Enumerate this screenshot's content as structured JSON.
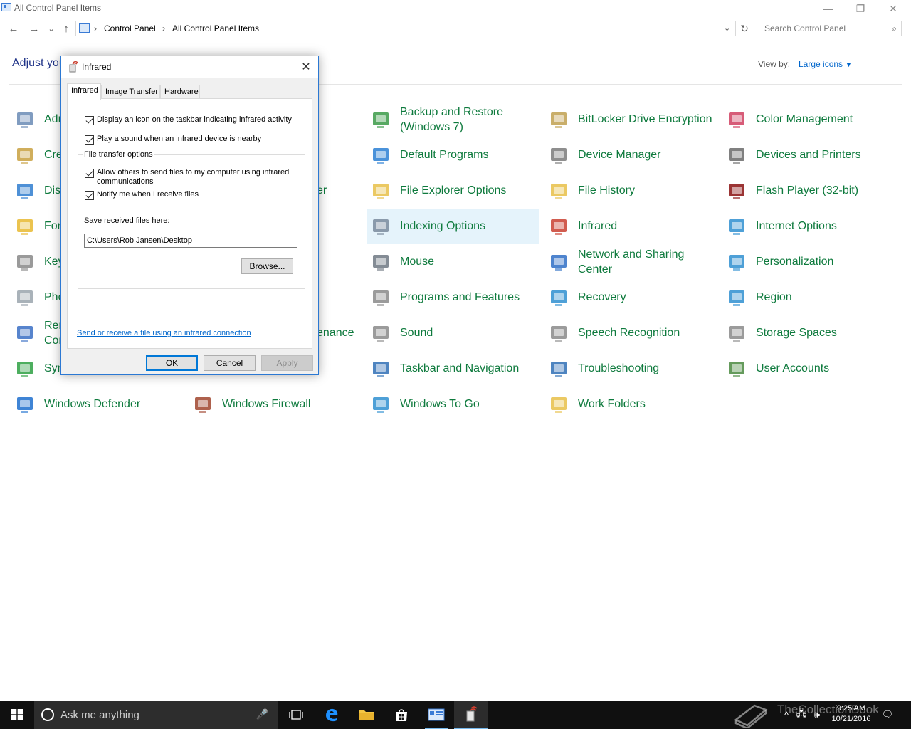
{
  "window": {
    "title": "All Control Panel Items",
    "minimize": "—",
    "restore": "❐",
    "close": "✕"
  },
  "addressbar": {
    "back": "←",
    "forward": "→",
    "recent": "⌄",
    "up": "↑",
    "breadcrumb": [
      "Control Panel",
      "All Control Panel Items"
    ],
    "separator": "›",
    "dropdown": "⌄",
    "refresh": "↻",
    "search_placeholder": "Search Control Panel",
    "search_icon": "⌕"
  },
  "heading": "Adjust you",
  "view_by": {
    "label": "View by:",
    "value": "Large icons",
    "caret": "▼"
  },
  "items": [
    {
      "label": "Adr",
      "icon": "administrative-tools-icon",
      "color": "#6a8bb5"
    },
    {
      "label": "Cre",
      "icon": "credential-manager-icon",
      "color": "#c8a040"
    },
    {
      "label": "Dis",
      "icon": "display-icon",
      "color": "#2f7dcf"
    },
    {
      "label": "For",
      "icon": "fonts-icon",
      "color": "#e8b830"
    },
    {
      "label": "Key",
      "icon": "keyboard-icon",
      "color": "#888888"
    },
    {
      "label": "Pho",
      "icon": "phone-and-modem-icon",
      "color": "#9aa4ad"
    },
    {
      "label": "Rer\nCor",
      "icon": "remoteapp-icon",
      "color": "#3a6fc4"
    },
    {
      "label": "Syr",
      "icon": "sync-center-icon",
      "color": "#2ea043"
    },
    {
      "label": "Windows Defender",
      "icon": "windows-defender-icon",
      "color": "#1d6fce"
    },
    {
      "label": "er",
      "icon": "",
      "color": ""
    },
    {
      "label": "enance",
      "icon": "",
      "color": ""
    },
    {
      "label": "Windows Firewall",
      "icon": "windows-firewall-icon",
      "color": "#a0452e"
    },
    {
      "label": "Backup and Restore\n(Windows 7)",
      "icon": "backup-restore-icon",
      "color": "#3b9a48"
    },
    {
      "label": "Default Programs",
      "icon": "default-programs-icon",
      "color": "#2a7fd4"
    },
    {
      "label": "File Explorer Options",
      "icon": "file-explorer-options-icon",
      "color": "#e8c048"
    },
    {
      "label": "Indexing Options",
      "icon": "indexing-options-icon",
      "color": "#7a8a9c"
    },
    {
      "label": "Mouse",
      "icon": "mouse-icon",
      "color": "#6f7882"
    },
    {
      "label": "Programs and Features",
      "icon": "programs-features-icon",
      "color": "#8a8a8a"
    },
    {
      "label": "Sound",
      "icon": "sound-icon",
      "color": "#8a8a8a"
    },
    {
      "label": "Taskbar and Navigation",
      "icon": "taskbar-navigation-icon",
      "color": "#2f6fb5"
    },
    {
      "label": "Windows To Go",
      "icon": "windows-to-go-icon",
      "color": "#2f8fd0"
    },
    {
      "label": "BitLocker Drive Encryption",
      "icon": "bitlocker-icon",
      "color": "#c0a050"
    },
    {
      "label": "Device Manager",
      "icon": "device-manager-icon",
      "color": "#7a7a7a"
    },
    {
      "label": "File History",
      "icon": "file-history-icon",
      "color": "#e8c048"
    },
    {
      "label": "Infrared",
      "icon": "infrared-icon",
      "color": "#c94030"
    },
    {
      "label": "Network and Sharing\nCenter",
      "icon": "network-sharing-icon",
      "color": "#2f6fc5"
    },
    {
      "label": "Recovery",
      "icon": "recovery-icon",
      "color": "#2f8fd0"
    },
    {
      "label": "Speech Recognition",
      "icon": "speech-recognition-icon",
      "color": "#8a8a8a"
    },
    {
      "label": "Troubleshooting",
      "icon": "troubleshooting-icon",
      "color": "#2f6fb5"
    },
    {
      "label": "Work Folders",
      "icon": "work-folders-icon",
      "color": "#e8c048"
    },
    {
      "label": "Color Management",
      "icon": "color-management-icon",
      "color": "#d04060"
    },
    {
      "label": "Devices and Printers",
      "icon": "devices-printers-icon",
      "color": "#6a6a6a"
    },
    {
      "label": "Flash Player (32-bit)",
      "icon": "flash-player-icon",
      "color": "#8a1010"
    },
    {
      "label": "Internet Options",
      "icon": "internet-options-icon",
      "color": "#2f8fd0"
    },
    {
      "label": "Personalization",
      "icon": "personalization-icon",
      "color": "#2f8fd0"
    },
    {
      "label": "Region",
      "icon": "region-icon",
      "color": "#2f8fd0"
    },
    {
      "label": "Storage Spaces",
      "icon": "storage-spaces-icon",
      "color": "#8a8a8a"
    },
    {
      "label": "User Accounts",
      "icon": "user-accounts-icon",
      "color": "#4a8a40"
    }
  ],
  "dialog": {
    "title": "Infrared",
    "close": "✕",
    "tabs": [
      "Infrared",
      "Image Transfer",
      "Hardware"
    ],
    "options": [
      {
        "label": "Display an icon on the taskbar indicating infrared activity",
        "checked": true
      },
      {
        "label": "Play a sound when an infrared device is nearby",
        "checked": true
      }
    ],
    "group_title": "File transfer options",
    "group_options": [
      {
        "label": "Allow others to send files to my computer using infrared communications",
        "checked": true
      },
      {
        "label": "Notify me when I receive files",
        "checked": true
      }
    ],
    "save_label": "Save received files here:",
    "save_path": "C:\\Users\\Rob Jansen\\Desktop",
    "browse": "Browse...",
    "link": "Send or receive a file using an infrared connection",
    "ok": "OK",
    "cancel": "Cancel",
    "apply": "Apply"
  },
  "taskbar": {
    "search_text": "Ask me anything",
    "mic": "🎤",
    "time": "9:25 AM",
    "date": "10/21/2016",
    "watermark": "TheCollectionBook",
    "tray_up": "^",
    "tray_network": "🖧",
    "tray_volume": "🕪",
    "tray_notification": "🗨"
  },
  "colors": {
    "link_green": "#0e7a3d",
    "heading_blue": "#1e3287",
    "dialog_border": "#2b78d3",
    "highlight": "#e5f3fb",
    "taskbar": "#101010"
  }
}
